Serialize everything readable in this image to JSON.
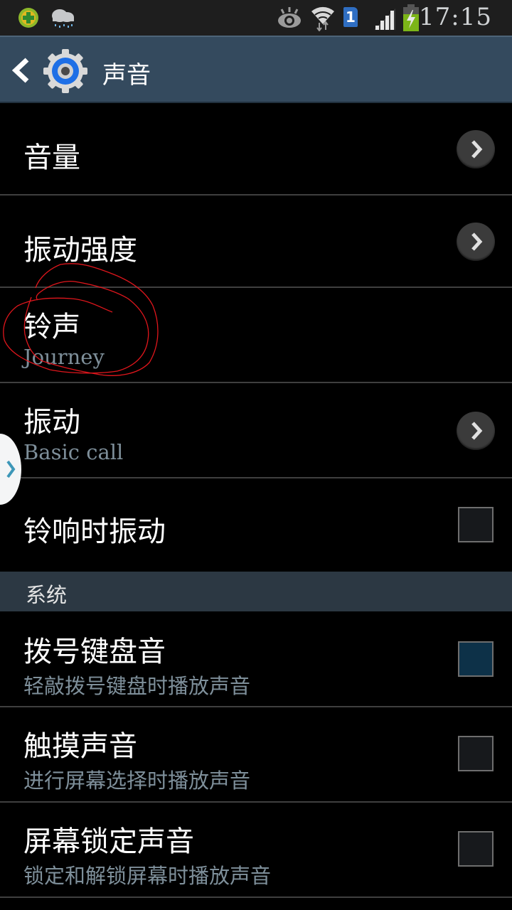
{
  "status_bar": {
    "time": "17:15",
    "icons": [
      "security-app-icon",
      "weather-rain-icon",
      "eye-icon",
      "wifi-icon",
      "sim1-icon",
      "signal-icon",
      "battery-charging-icon"
    ],
    "sim_label": "1"
  },
  "action_bar": {
    "title": "声音",
    "back_icon": "chevron-left-icon",
    "app_icon": "settings-gear-icon"
  },
  "items": [
    {
      "title": "音量",
      "control": "arrow"
    },
    {
      "title": "振动强度",
      "control": "arrow"
    },
    {
      "title": "铃声",
      "summary": "Journey",
      "control": "none"
    },
    {
      "title": "振动",
      "summary": "Basic call",
      "control": "arrow"
    },
    {
      "title": "铃响时振动",
      "control": "checkbox",
      "checked": false
    }
  ],
  "section": {
    "label": "系统"
  },
  "system_items": [
    {
      "title": "拨号键盘音",
      "summary": "轻敲拨号键盘时播放声音",
      "control": "checkbox",
      "checked": false,
      "focused": true
    },
    {
      "title": "触摸声音",
      "summary": "进行屏幕选择时播放声音",
      "control": "checkbox",
      "checked": false
    },
    {
      "title": "屏幕锁定声音",
      "summary": "锁定和解锁屏幕时播放声音",
      "control": "checkbox",
      "checked": false
    }
  ],
  "colors": {
    "action_bar": "#344a5e",
    "section_header": "#2c3843",
    "summary_text": "#7e8f9a",
    "annotation": "#e0161c"
  }
}
